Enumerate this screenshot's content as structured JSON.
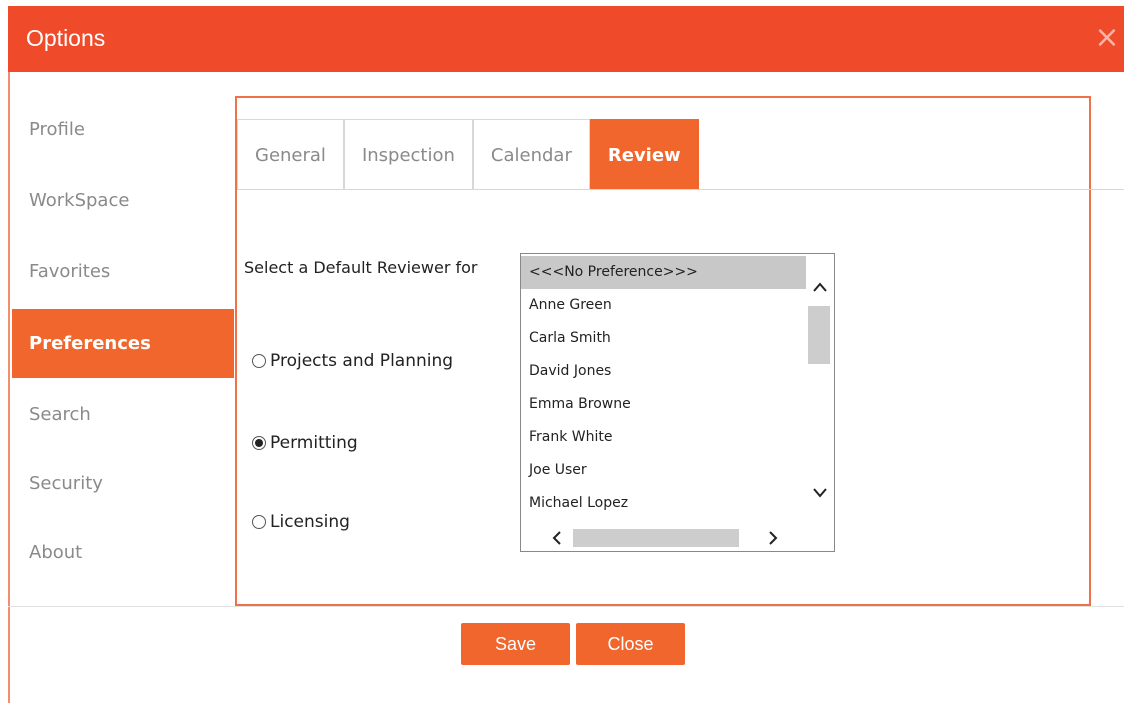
{
  "dialog": {
    "title": "Options",
    "close_icon": "close-icon"
  },
  "sidebar": {
    "items": [
      {
        "label": "Profile",
        "active": false
      },
      {
        "label": "WorkSpace",
        "active": false
      },
      {
        "label": "Favorites",
        "active": false
      },
      {
        "label": "Preferences",
        "active": true
      },
      {
        "label": "Search",
        "active": false
      },
      {
        "label": "Security",
        "active": false
      },
      {
        "label": "About",
        "active": false
      }
    ]
  },
  "tabs": [
    {
      "label": "General",
      "active": false
    },
    {
      "label": "Inspection",
      "active": false
    },
    {
      "label": "Calendar",
      "active": false
    },
    {
      "label": "Review",
      "active": true
    }
  ],
  "review": {
    "prompt": "Select a Default Reviewer for",
    "options": [
      {
        "label": "Projects and Planning",
        "checked": false
      },
      {
        "label": "Permitting",
        "checked": true
      },
      {
        "label": "Licensing",
        "checked": false
      }
    ],
    "reviewers": [
      "<<<No Preference>>>",
      "Anne Green",
      "Carla Smith",
      "David Jones",
      "Emma Browne",
      "Frank White",
      "Joe User",
      "Michael Lopez"
    ],
    "selected_reviewer": "<<<No Preference>>>"
  },
  "footer": {
    "save_label": "Save",
    "close_label": "Close"
  },
  "colors": {
    "titlebar": "#ef4a2a",
    "accent": "#f0662d",
    "panel_border": "#f07048"
  }
}
